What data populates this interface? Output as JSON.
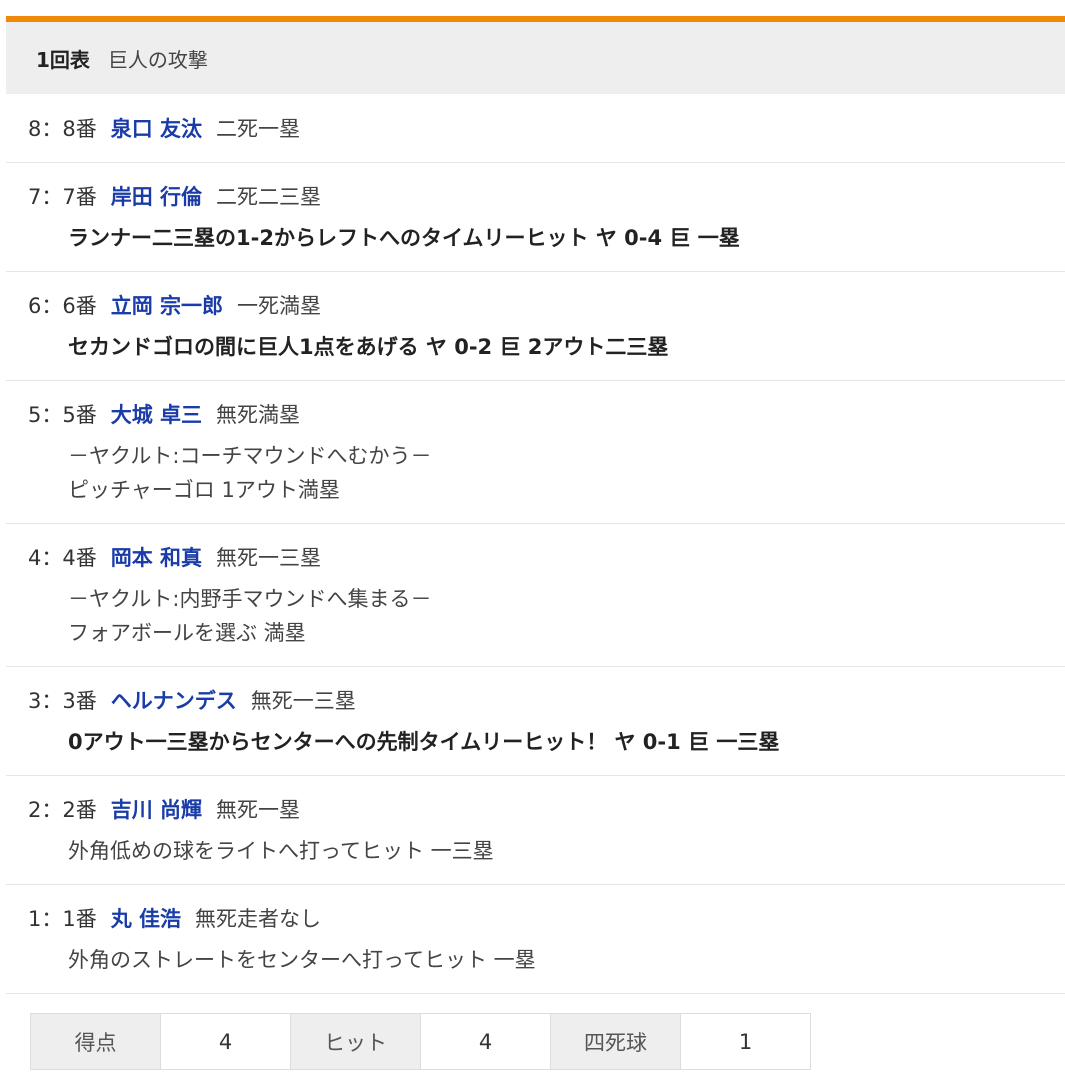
{
  "inning": {
    "label": "1回表",
    "team": "巨人の攻撃"
  },
  "plate_appearances": [
    {
      "order": "8：8番",
      "player": "泉口 友汰",
      "situation": "二死一塁",
      "details": []
    },
    {
      "order": "7：7番",
      "player": "岸田 行倫",
      "situation": "二死二三塁",
      "details": [
        {
          "text": "ランナー二三塁の1-2からレフトへのタイムリーヒット ヤ 0-4 巨 一塁",
          "bold": true
        }
      ]
    },
    {
      "order": "6：6番",
      "player": "立岡 宗一郎",
      "situation": "一死満塁",
      "details": [
        {
          "text": "セカンドゴロの間に巨人1点をあげる ヤ 0-2 巨 2アウト二三塁",
          "bold": true
        }
      ]
    },
    {
      "order": "5：5番",
      "player": "大城 卓三",
      "situation": "無死満塁",
      "details": [
        {
          "text": "－ヤクルト:コーチマウンドへむかう－",
          "bold": false
        },
        {
          "text": "ピッチャーゴロ 1アウト満塁",
          "bold": false
        }
      ]
    },
    {
      "order": "4：4番",
      "player": "岡本 和真",
      "situation": "無死一三塁",
      "details": [
        {
          "text": "－ヤクルト:内野手マウンドへ集まる－",
          "bold": false
        },
        {
          "text": "フォアボールを選ぶ 満塁",
          "bold": false
        }
      ]
    },
    {
      "order": "3：3番",
      "player": "ヘルナンデス",
      "situation": "無死一三塁",
      "details": [
        {
          "text": "0アウト一三塁からセンターへの先制タイムリーヒット！ ヤ 0-1 巨 一三塁",
          "bold": true
        }
      ]
    },
    {
      "order": "2：2番",
      "player": "吉川 尚輝",
      "situation": "無死一塁",
      "details": [
        {
          "text": "外角低めの球をライトへ打ってヒット 一三塁",
          "bold": false
        }
      ]
    },
    {
      "order": "1：1番",
      "player": "丸 佳浩",
      "situation": "無死走者なし",
      "details": [
        {
          "text": "外角のストレートをセンターへ打ってヒット 一塁",
          "bold": false
        }
      ]
    }
  ],
  "summary": {
    "runs_label": "得点",
    "runs_value": "4",
    "hits_label": "ヒット",
    "hits_value": "4",
    "walks_label": "四死球",
    "walks_value": "1"
  },
  "colors": {
    "accent": "#ee8a08",
    "player_link": "#1a3ca8",
    "header_bg": "#eeeeee"
  }
}
